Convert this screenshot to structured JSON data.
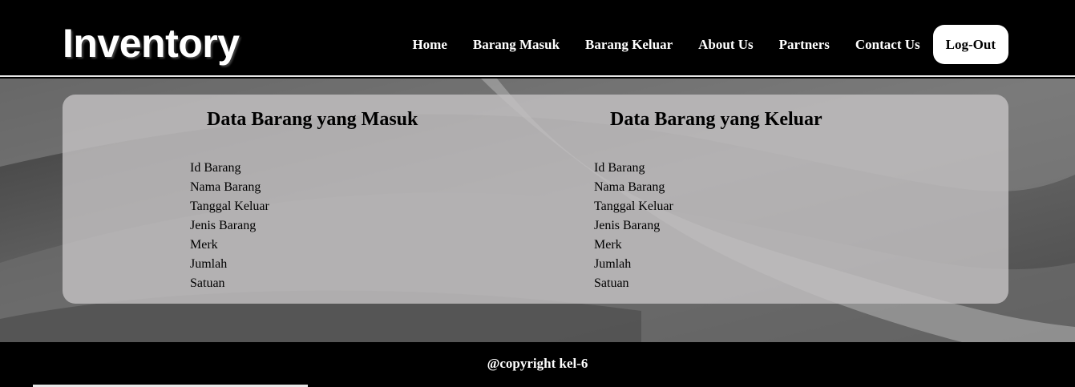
{
  "header": {
    "brand": "Inventory",
    "nav": [
      {
        "label": "Home"
      },
      {
        "label": "Barang Masuk"
      },
      {
        "label": "Barang Keluar"
      },
      {
        "label": "About Us"
      },
      {
        "label": "Partners"
      },
      {
        "label": "Contact Us"
      },
      {
        "label": "Log-Out"
      }
    ]
  },
  "main": {
    "masuk": {
      "title": "Data Barang yang Masuk",
      "fields": [
        "Id Barang",
        "Nama Barang",
        "Tanggal Keluar",
        "Jenis Barang",
        "Merk",
        "Jumlah",
        "Satuan"
      ]
    },
    "keluar": {
      "title": "Data Barang yang Keluar",
      "fields": [
        "Id Barang",
        "Nama Barang",
        "Tanggal Keluar",
        "Jenis Barang",
        "Merk",
        "Jumlah",
        "Satuan"
      ]
    }
  },
  "footer": {
    "copyright": "@copyright kel-6"
  }
}
